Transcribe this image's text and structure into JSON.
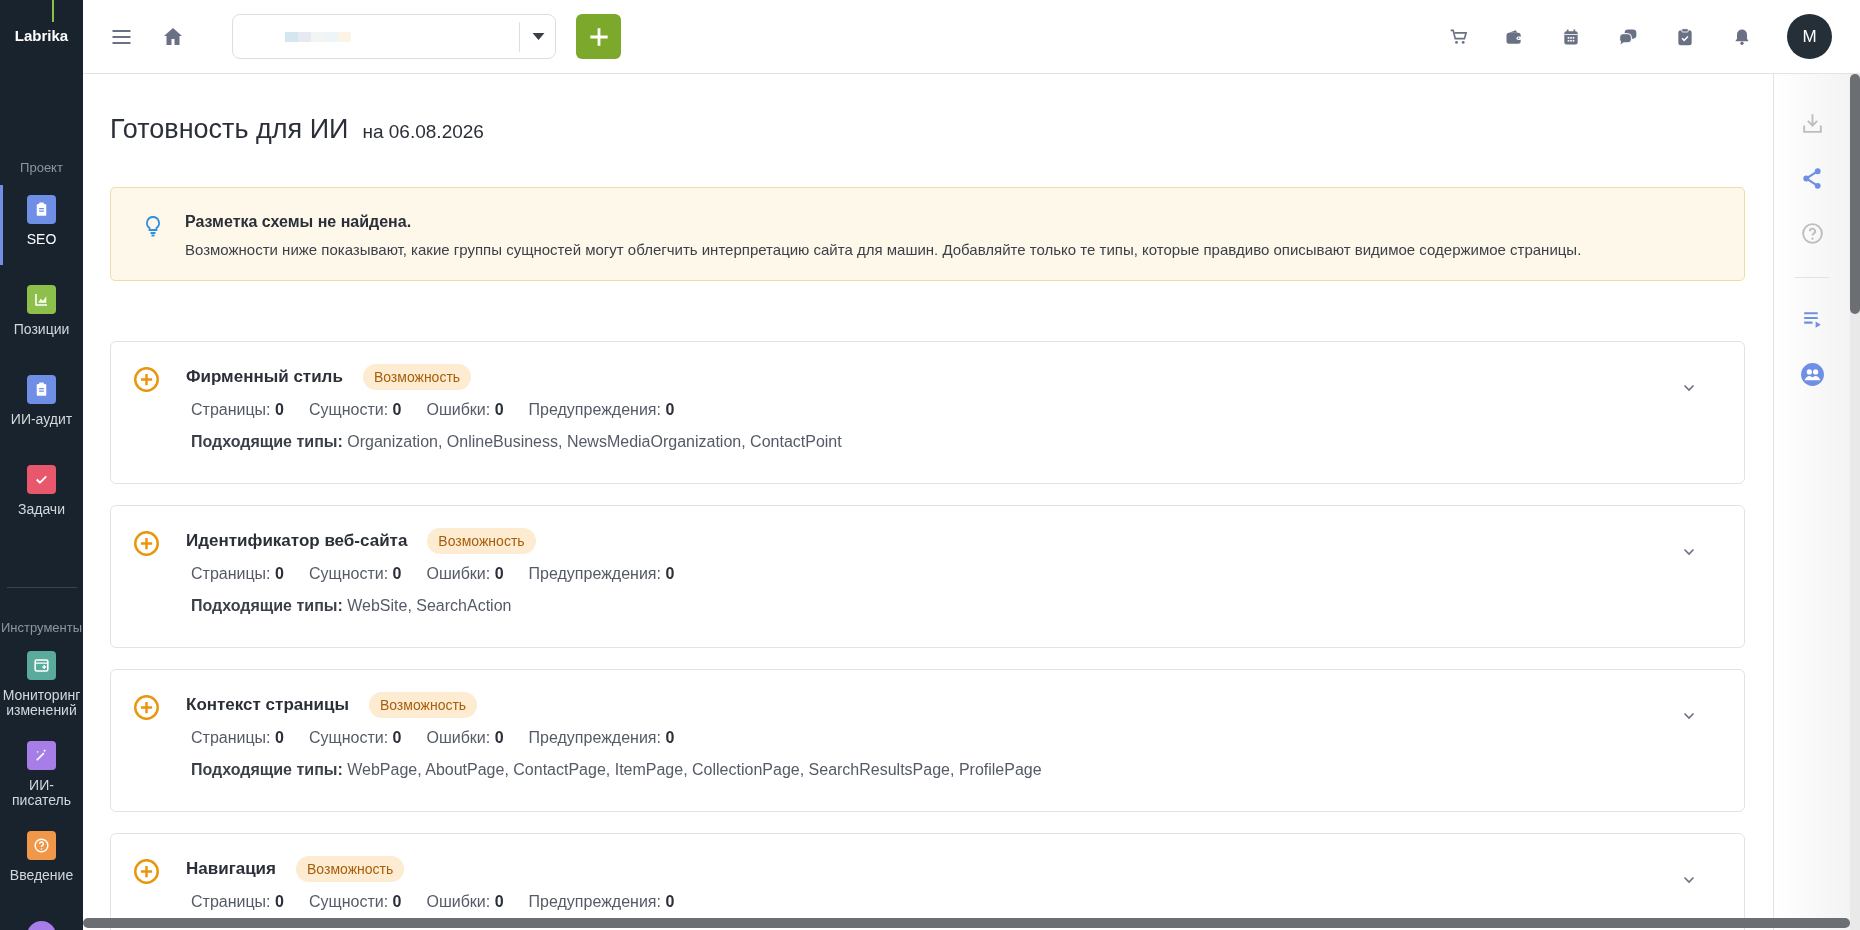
{
  "sidebar": {
    "logo": "Labrika",
    "sections": [
      {
        "label": "Проект",
        "items": [
          {
            "label": "SEO",
            "selected": true,
            "color": "#6f8fe6"
          },
          {
            "label": "Позиции",
            "selected": false,
            "color": "#8dc04a"
          },
          {
            "label": "ИИ-аудит",
            "selected": false,
            "color": "#6f8fe6"
          },
          {
            "label": "Задачи",
            "selected": false,
            "color": "#e9576d"
          }
        ]
      },
      {
        "label": "Инструменты",
        "items": [
          {
            "label": "Мониторинг изменений",
            "selected": false,
            "color": "#5aab9c"
          },
          {
            "label": "ИИ-писатель",
            "selected": false,
            "color": "#a77de8"
          },
          {
            "label": "Введение",
            "selected": false,
            "color": "#f0974a"
          }
        ]
      }
    ]
  },
  "topbar": {
    "avatar": "M"
  },
  "page": {
    "title": "Готовность для ИИ",
    "date": "на 06.08.2026"
  },
  "alert": {
    "title": "Разметка схемы не найдена.",
    "text": "Возможности ниже показывают, какие группы сущностей могут облегчить интерпретацию сайта для машин. Добавляйте только те типы, которые правдиво описывают видимое содержимое страницы."
  },
  "cards": [
    {
      "title": "Фирменный стиль",
      "badge": "Возможность",
      "expanded": false,
      "stats": [
        "Страницы: **0**",
        "Сущности: **0**",
        "Ошибки: **0**",
        "Предупреждения: **0**"
      ],
      "types": "**Подходящие типы:** Organization, OnlineBusiness, NewsMediaOrganization, ContactPoint"
    },
    {
      "title": "Идентификатор веб-сайта",
      "badge": "Возможность",
      "expanded": false,
      "stats": [
        "Страницы: **0**",
        "Сущности: **0**",
        "Ошибки: **0**",
        "Предупреждения: **0**"
      ],
      "types": "**Подходящие типы:** WebSite, SearchAction"
    },
    {
      "title": "Контекст страницы",
      "badge": "Возможность",
      "expanded": false,
      "stats": [
        "Страницы: **0**",
        "Сущности: **0**",
        "Ошибки: **0**",
        "Предупреждения: **0**"
      ],
      "types": "**Подходящие типы:** WebPage, AboutPage, ContactPage, ItemPage, CollectionPage, SearchResultsPage, ProfilePage"
    },
    {
      "title": "Навигация",
      "badge": "Возможность",
      "expanded": false,
      "stats": [
        "Страницы: **0**",
        "Сущности: **0**",
        "Ошибки: **0**",
        "Предупреждения: **0**"
      ]
    }
  ]
}
